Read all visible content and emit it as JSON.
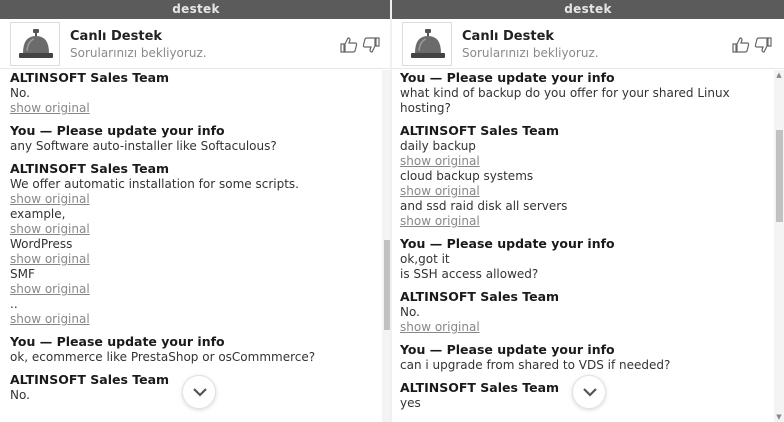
{
  "left": {
    "window_title": "destek",
    "agent_name": "Canlı Destek",
    "agent_subtitle": "Sorularınızı bekliyoruz.",
    "messages": [
      {
        "sender": "ALTINSOFT Sales Team",
        "parts": [
          {
            "text": "No.",
            "show_original": "show original"
          }
        ]
      },
      {
        "sender": "You — Please update your info",
        "parts": [
          {
            "text": "any Software auto-installer like Softaculous?"
          }
        ]
      },
      {
        "sender": "ALTINSOFT Sales Team",
        "parts": [
          {
            "text": "We offer automatic installation for some scripts.",
            "show_original": "show original"
          },
          {
            "text": "example,",
            "show_original": "show original"
          },
          {
            "text": "WordPress",
            "show_original": "show original"
          },
          {
            "text": "SMF",
            "show_original": "show original"
          },
          {
            "text": "..",
            "show_original": "show original"
          }
        ]
      },
      {
        "sender": "You — Please update your info",
        "parts": [
          {
            "text": "ok, ecommerce like PrestaShop or osCommmerce?"
          }
        ]
      },
      {
        "sender": "ALTINSOFT Sales Team",
        "parts": [
          {
            "text": "No."
          }
        ]
      }
    ]
  },
  "right": {
    "window_title": "destek",
    "agent_name": "Canlı Destek",
    "agent_subtitle": "Sorularınızı bekliyoruz.",
    "messages": [
      {
        "sender": "You — Please update your info",
        "parts": [
          {
            "text": "what kind of backup do you offer for your shared Linux"
          },
          {
            "text": "hosting?"
          }
        ]
      },
      {
        "sender": "ALTINSOFT Sales Team",
        "parts": [
          {
            "text": "daily backup",
            "show_original": "show original"
          },
          {
            "text": "cloud backup systems",
            "show_original": "show original"
          },
          {
            "text": "and ssd raid disk all servers",
            "show_original": "show original"
          }
        ]
      },
      {
        "sender": "You — Please update your info",
        "parts": [
          {
            "text": "ok,got it"
          },
          {
            "text": "is SSH access allowed?"
          }
        ]
      },
      {
        "sender": "ALTINSOFT Sales Team",
        "parts": [
          {
            "text": "No.",
            "show_original": "show original"
          }
        ]
      },
      {
        "sender": "You — Please update your info",
        "parts": [
          {
            "text": "can i upgrade from shared to VDS if needed?"
          }
        ]
      },
      {
        "sender": "ALTINSOFT Sales Team",
        "parts": [
          {
            "text": "yes"
          }
        ]
      }
    ]
  },
  "icons": {
    "avatar": "service-bell-icon",
    "like": "thumbs-up-icon",
    "dislike": "thumbs-down-icon",
    "scroll_down": "chevron-down-icon"
  },
  "colors": {
    "topbar_bg": "#5b5b5b",
    "link_gray": "#888888",
    "text_dark": "#1a1a1a"
  }
}
